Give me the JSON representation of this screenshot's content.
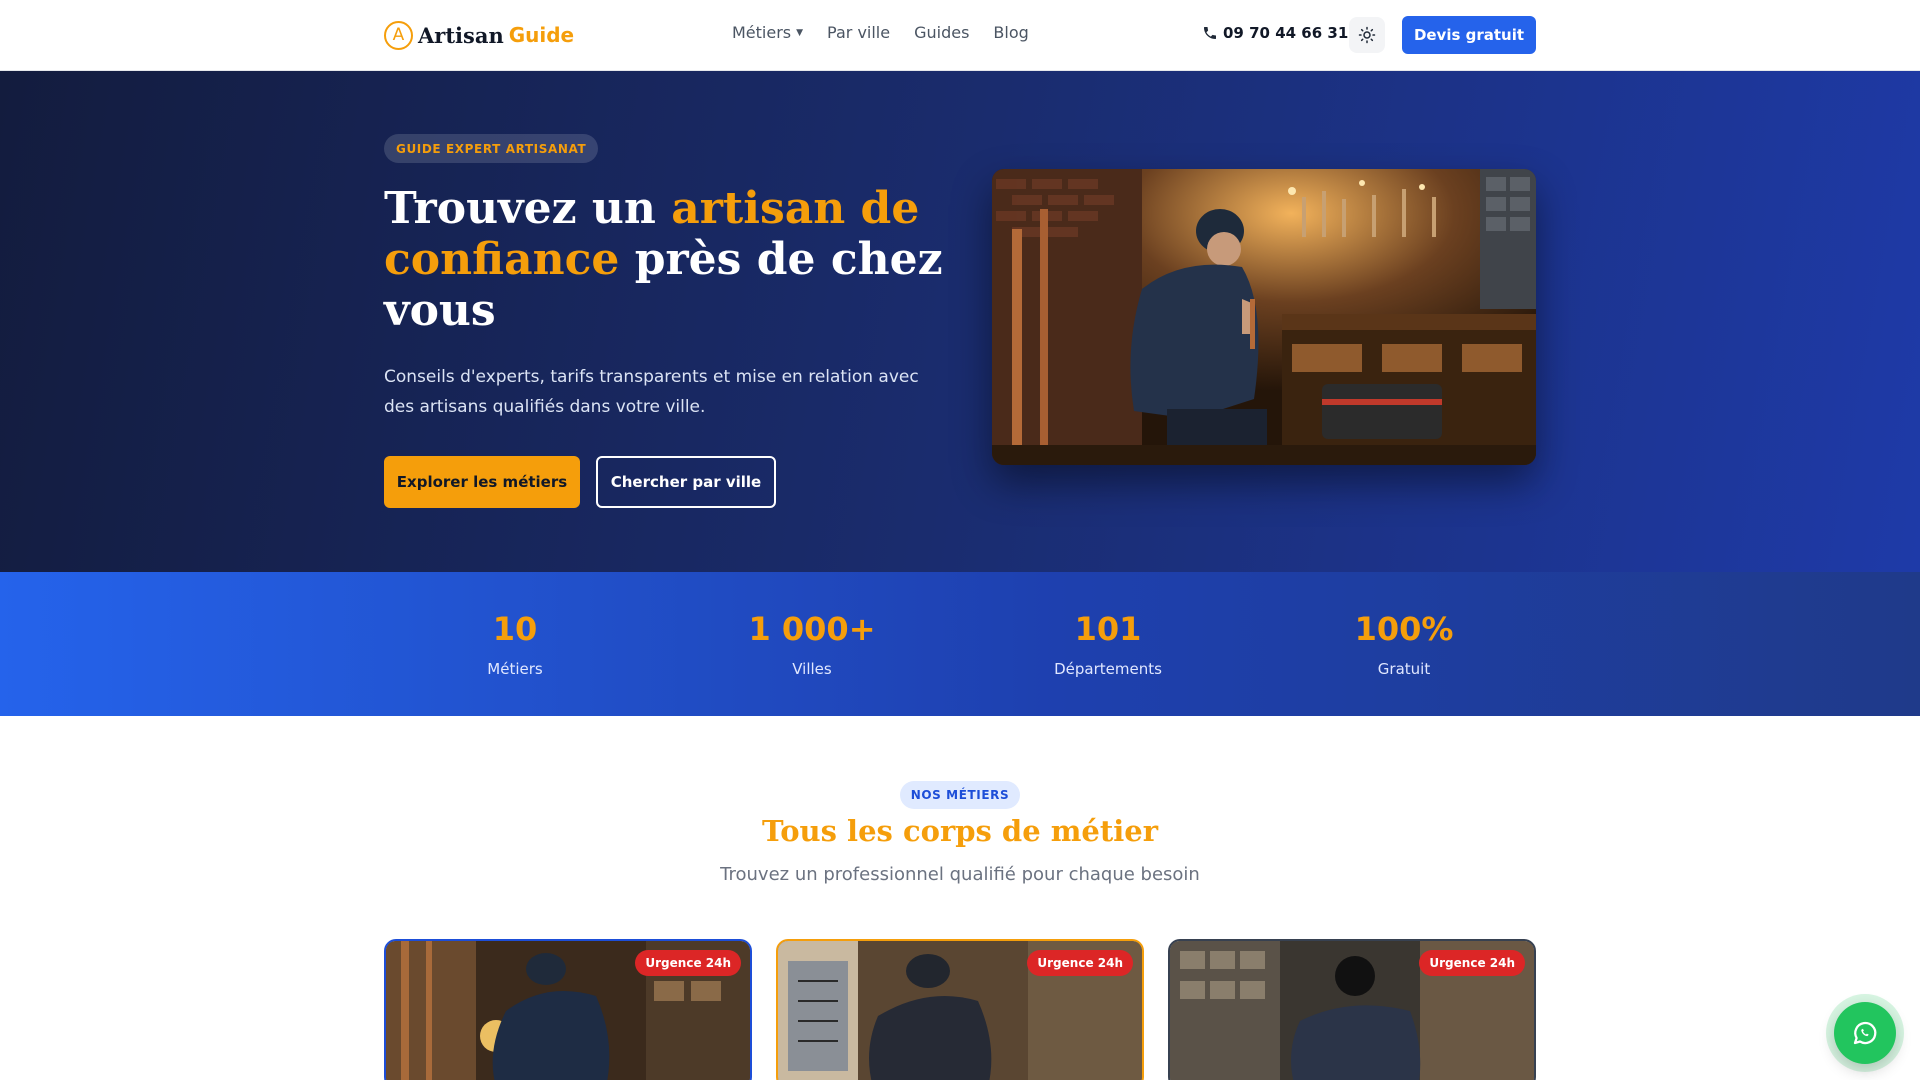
{
  "header": {
    "logo_icon": "A",
    "logo_text": "Artisan",
    "logo_accent": "Guide",
    "nav": [
      {
        "label": "Métiers",
        "has_dropdown": true
      },
      {
        "label": "Par ville"
      },
      {
        "label": "Guides"
      },
      {
        "label": "Blog"
      }
    ],
    "phone": "09 70 44 66 31",
    "theme_icon": "sun-icon",
    "cta_label": "Devis gratuit"
  },
  "hero": {
    "badge": "GUIDE EXPERT ARTISANAT",
    "title_part1": "Trouvez un ",
    "title_highlight": "artisan de confiance",
    "title_part2": " près de chez vous",
    "subtitle": "Conseils d'experts, tarifs transparents et mise en relation avec des artisans qualifiés dans votre ville.",
    "btn_primary": "Explorer les métiers",
    "btn_secondary": "Chercher par ville"
  },
  "stats": [
    {
      "value": "10",
      "label": "Métiers"
    },
    {
      "value": "1 000+",
      "label": "Villes"
    },
    {
      "value": "101",
      "label": "Départements"
    },
    {
      "value": "100%",
      "label": "Gratuit"
    }
  ],
  "section": {
    "badge": "NOS MÉTIERS",
    "title": "Tous les corps de métier",
    "subtitle": "Trouvez un professionnel qualifié pour chaque besoin"
  },
  "cards": [
    {
      "badge": "Urgence 24h",
      "border_color": "#1d4ed8"
    },
    {
      "badge": "Urgence 24h",
      "border_color": "#f59e0b"
    },
    {
      "badge": "Urgence 24h",
      "border_color": "#374151"
    }
  ],
  "colors": {
    "accent": "#f59e0b",
    "primary": "#2563eb",
    "hero_dark": "#131c3e",
    "urgent": "#dc2626",
    "whatsapp": "#22c55e"
  },
  "whatsapp_icon": "whatsapp-icon"
}
